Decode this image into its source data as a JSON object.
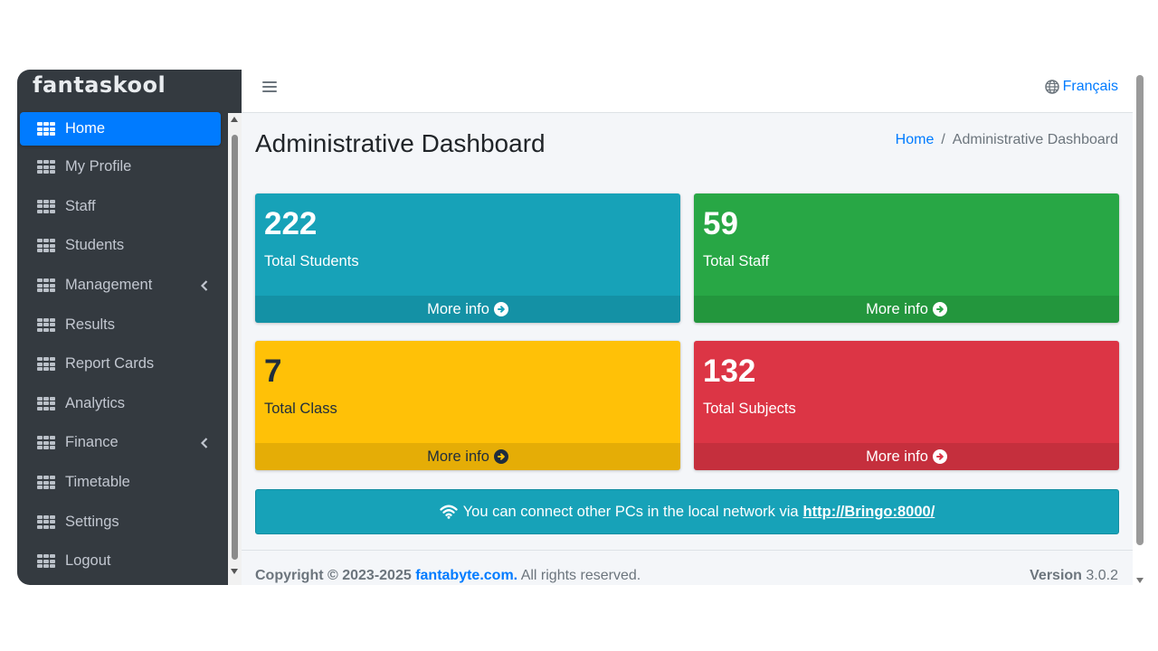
{
  "brand": "fantaskool",
  "sidebar": {
    "items": [
      {
        "label": "Home",
        "active": true
      },
      {
        "label": "My Profile"
      },
      {
        "label": "Staff"
      },
      {
        "label": "Students"
      },
      {
        "label": "Management",
        "has_submenu": true
      },
      {
        "label": "Results"
      },
      {
        "label": "Report Cards"
      },
      {
        "label": "Analytics"
      },
      {
        "label": "Finance",
        "has_submenu": true
      },
      {
        "label": "Timetable"
      },
      {
        "label": "Settings"
      },
      {
        "label": "Logout"
      }
    ]
  },
  "topbar": {
    "language": "Français"
  },
  "page": {
    "title": "Administrative Dashboard",
    "breadcrumb": {
      "home": "Home",
      "separator": "/",
      "current": "Administrative Dashboard"
    }
  },
  "stats": [
    {
      "value": "222",
      "label": "Total Students",
      "more": "More info",
      "color": "#17a2b8"
    },
    {
      "value": "59",
      "label": "Total Staff",
      "more": "More info",
      "color": "#28a745"
    },
    {
      "value": "7",
      "label": "Total Class",
      "more": "More info",
      "color": "#ffc107"
    },
    {
      "value": "132",
      "label": "Total Subjects",
      "more": "More info",
      "color": "#dc3545"
    }
  ],
  "notice": {
    "text": "You can connect other PCs in the local network via",
    "url": "http://Bringo:8000/"
  },
  "footer": {
    "copyright": "Copyright © 2023-2025",
    "company": "fantabyte.com.",
    "rights": "All rights reserved.",
    "version_label": "Version",
    "version": "3.0.2"
  },
  "colors": {
    "sidebar_bg": "#343a40",
    "active": "#007bff",
    "link": "#007bff"
  }
}
